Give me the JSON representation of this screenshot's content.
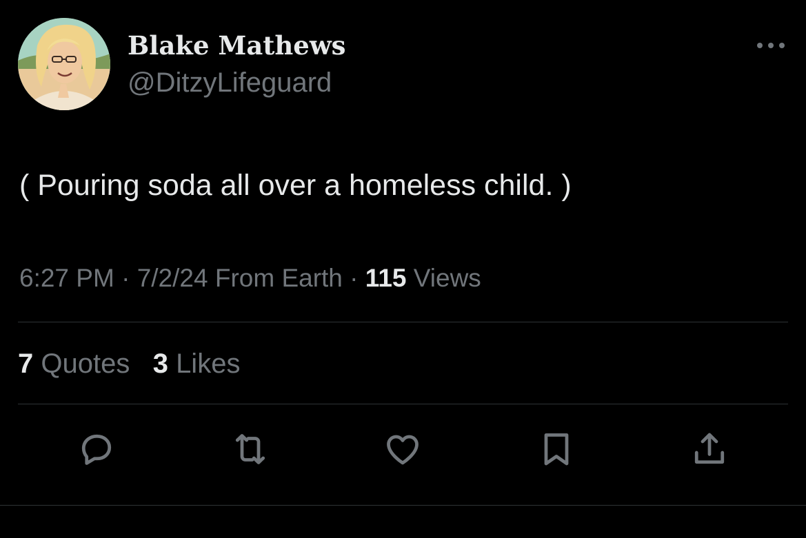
{
  "author": {
    "display_name": "Blake Mathews",
    "handle": "@DitzyLifeguard"
  },
  "tweet": {
    "text": "( Pouring soda all over a homeless child. )",
    "time": "6:27 PM",
    "date": "7/2/24",
    "source": "From Earth",
    "views_count": "115",
    "views_label": "Views",
    "separator": "·"
  },
  "stats": {
    "quotes_count": "7",
    "quotes_label": "Quotes",
    "likes_count": "3",
    "likes_label": "Likes"
  },
  "icons": {
    "more": "more-horizontal-icon",
    "reply": "reply-icon",
    "retweet": "retweet-icon",
    "like": "heart-icon",
    "bookmark": "bookmark-icon",
    "share": "share-icon"
  },
  "colors": {
    "background": "#000000",
    "primary_text": "#e7e9ea",
    "secondary_text": "#71767b",
    "divider": "#2f3336"
  }
}
